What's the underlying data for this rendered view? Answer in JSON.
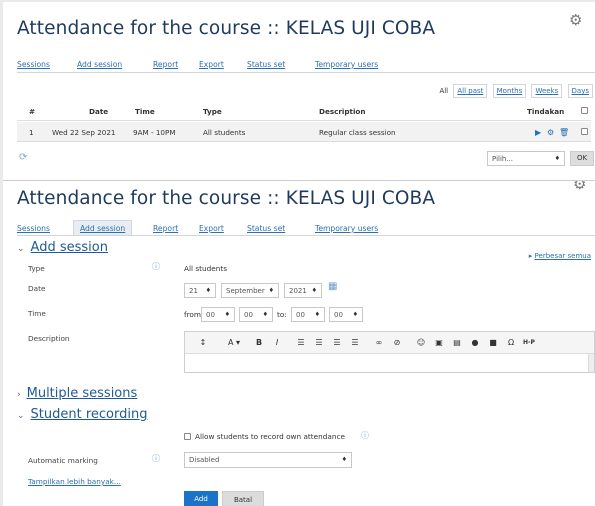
{
  "panel1": {
    "title": "Attendance for the course :: KELAS UJI COBA",
    "tabs": [
      "Sessions",
      "Add session",
      "Report",
      "Export",
      "Status set",
      "Temporary users"
    ],
    "view_label": "All",
    "view_links": [
      "All past",
      "Months",
      "Weeks",
      "Days"
    ],
    "columns": [
      "#",
      "Date",
      "Time",
      "Type",
      "Description",
      "Tindakan"
    ],
    "row": {
      "num": "1",
      "date": "Wed 22 Sep 2021",
      "time": "9AM - 10PM",
      "type": "All students",
      "description": "Regular class session",
      "action_icons": [
        "play-icon",
        "gear-icon",
        "trash-icon"
      ]
    },
    "select_placeholder": "Pilih...",
    "ok_label": "OK"
  },
  "panel2": {
    "title": "Attendance for the course :: KELAS UJI COBA",
    "tabs": [
      "Sessions",
      "Add session",
      "Report",
      "Export",
      "Status set",
      "Temporary users"
    ],
    "active_tab": "Add session",
    "expand_all": "Perbesar semua",
    "add_session": {
      "heading": "Add session",
      "type_label": "Type",
      "type_value": "All students",
      "date_label": "Date",
      "day": "21",
      "month": "September",
      "year": "2021",
      "time_label": "Time",
      "from_label": "from:",
      "from_hour": "00",
      "from_min": "00",
      "to_label": "to:",
      "to_hour": "00",
      "to_min": "00",
      "description_label": "Description"
    },
    "multiple_sessions_heading": "Multiple sessions",
    "student_recording": {
      "heading": "Student recording",
      "allow_label": "Allow students to record own attendance",
      "auto_label": "Automatic marking",
      "auto_value": "Disabled",
      "show_more": "Tampilkan lebih banyak..."
    },
    "add_button": "Add",
    "cancel_button": "Batal"
  },
  "colors": {
    "title": "#1e3a5c",
    "link": "#2a6fb0",
    "primary_button": "#1a73c9"
  }
}
